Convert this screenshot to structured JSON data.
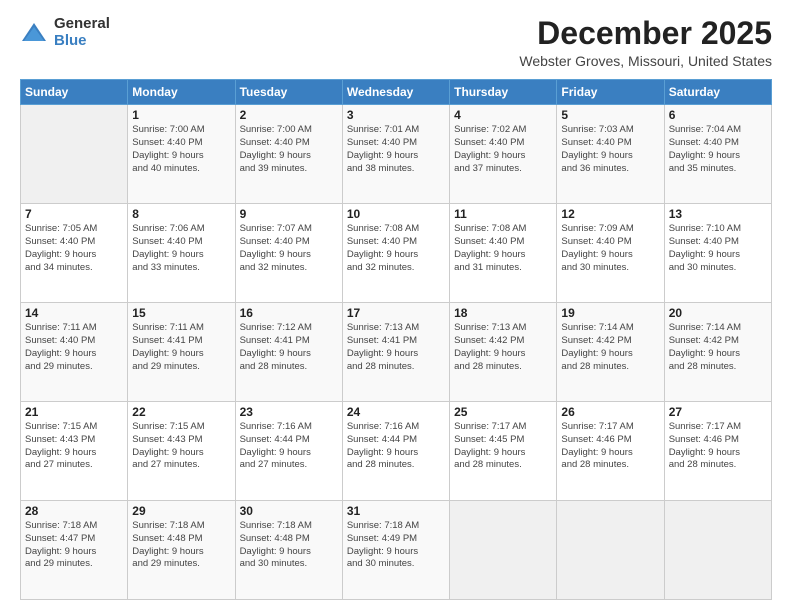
{
  "logo": {
    "general": "General",
    "blue": "Blue"
  },
  "header": {
    "title": "December 2025",
    "subtitle": "Webster Groves, Missouri, United States"
  },
  "days": [
    "Sunday",
    "Monday",
    "Tuesday",
    "Wednesday",
    "Thursday",
    "Friday",
    "Saturday"
  ],
  "weeks": [
    [
      {
        "day": "",
        "content": ""
      },
      {
        "day": "1",
        "content": "Sunrise: 7:00 AM\nSunset: 4:40 PM\nDaylight: 9 hours\nand 40 minutes."
      },
      {
        "day": "2",
        "content": "Sunrise: 7:00 AM\nSunset: 4:40 PM\nDaylight: 9 hours\nand 39 minutes."
      },
      {
        "day": "3",
        "content": "Sunrise: 7:01 AM\nSunset: 4:40 PM\nDaylight: 9 hours\nand 38 minutes."
      },
      {
        "day": "4",
        "content": "Sunrise: 7:02 AM\nSunset: 4:40 PM\nDaylight: 9 hours\nand 37 minutes."
      },
      {
        "day": "5",
        "content": "Sunrise: 7:03 AM\nSunset: 4:40 PM\nDaylight: 9 hours\nand 36 minutes."
      },
      {
        "day": "6",
        "content": "Sunrise: 7:04 AM\nSunset: 4:40 PM\nDaylight: 9 hours\nand 35 minutes."
      }
    ],
    [
      {
        "day": "7",
        "content": "Sunrise: 7:05 AM\nSunset: 4:40 PM\nDaylight: 9 hours\nand 34 minutes."
      },
      {
        "day": "8",
        "content": "Sunrise: 7:06 AM\nSunset: 4:40 PM\nDaylight: 9 hours\nand 33 minutes."
      },
      {
        "day": "9",
        "content": "Sunrise: 7:07 AM\nSunset: 4:40 PM\nDaylight: 9 hours\nand 32 minutes."
      },
      {
        "day": "10",
        "content": "Sunrise: 7:08 AM\nSunset: 4:40 PM\nDaylight: 9 hours\nand 32 minutes."
      },
      {
        "day": "11",
        "content": "Sunrise: 7:08 AM\nSunset: 4:40 PM\nDaylight: 9 hours\nand 31 minutes."
      },
      {
        "day": "12",
        "content": "Sunrise: 7:09 AM\nSunset: 4:40 PM\nDaylight: 9 hours\nand 30 minutes."
      },
      {
        "day": "13",
        "content": "Sunrise: 7:10 AM\nSunset: 4:40 PM\nDaylight: 9 hours\nand 30 minutes."
      }
    ],
    [
      {
        "day": "14",
        "content": "Sunrise: 7:11 AM\nSunset: 4:40 PM\nDaylight: 9 hours\nand 29 minutes."
      },
      {
        "day": "15",
        "content": "Sunrise: 7:11 AM\nSunset: 4:41 PM\nDaylight: 9 hours\nand 29 minutes."
      },
      {
        "day": "16",
        "content": "Sunrise: 7:12 AM\nSunset: 4:41 PM\nDaylight: 9 hours\nand 28 minutes."
      },
      {
        "day": "17",
        "content": "Sunrise: 7:13 AM\nSunset: 4:41 PM\nDaylight: 9 hours\nand 28 minutes."
      },
      {
        "day": "18",
        "content": "Sunrise: 7:13 AM\nSunset: 4:42 PM\nDaylight: 9 hours\nand 28 minutes."
      },
      {
        "day": "19",
        "content": "Sunrise: 7:14 AM\nSunset: 4:42 PM\nDaylight: 9 hours\nand 28 minutes."
      },
      {
        "day": "20",
        "content": "Sunrise: 7:14 AM\nSunset: 4:42 PM\nDaylight: 9 hours\nand 28 minutes."
      }
    ],
    [
      {
        "day": "21",
        "content": "Sunrise: 7:15 AM\nSunset: 4:43 PM\nDaylight: 9 hours\nand 27 minutes."
      },
      {
        "day": "22",
        "content": "Sunrise: 7:15 AM\nSunset: 4:43 PM\nDaylight: 9 hours\nand 27 minutes."
      },
      {
        "day": "23",
        "content": "Sunrise: 7:16 AM\nSunset: 4:44 PM\nDaylight: 9 hours\nand 27 minutes."
      },
      {
        "day": "24",
        "content": "Sunrise: 7:16 AM\nSunset: 4:44 PM\nDaylight: 9 hours\nand 28 minutes."
      },
      {
        "day": "25",
        "content": "Sunrise: 7:17 AM\nSunset: 4:45 PM\nDaylight: 9 hours\nand 28 minutes."
      },
      {
        "day": "26",
        "content": "Sunrise: 7:17 AM\nSunset: 4:46 PM\nDaylight: 9 hours\nand 28 minutes."
      },
      {
        "day": "27",
        "content": "Sunrise: 7:17 AM\nSunset: 4:46 PM\nDaylight: 9 hours\nand 28 minutes."
      }
    ],
    [
      {
        "day": "28",
        "content": "Sunrise: 7:18 AM\nSunset: 4:47 PM\nDaylight: 9 hours\nand 29 minutes."
      },
      {
        "day": "29",
        "content": "Sunrise: 7:18 AM\nSunset: 4:48 PM\nDaylight: 9 hours\nand 29 minutes."
      },
      {
        "day": "30",
        "content": "Sunrise: 7:18 AM\nSunset: 4:48 PM\nDaylight: 9 hours\nand 30 minutes."
      },
      {
        "day": "31",
        "content": "Sunrise: 7:18 AM\nSunset: 4:49 PM\nDaylight: 9 hours\nand 30 minutes."
      },
      {
        "day": "",
        "content": ""
      },
      {
        "day": "",
        "content": ""
      },
      {
        "day": "",
        "content": ""
      }
    ]
  ]
}
